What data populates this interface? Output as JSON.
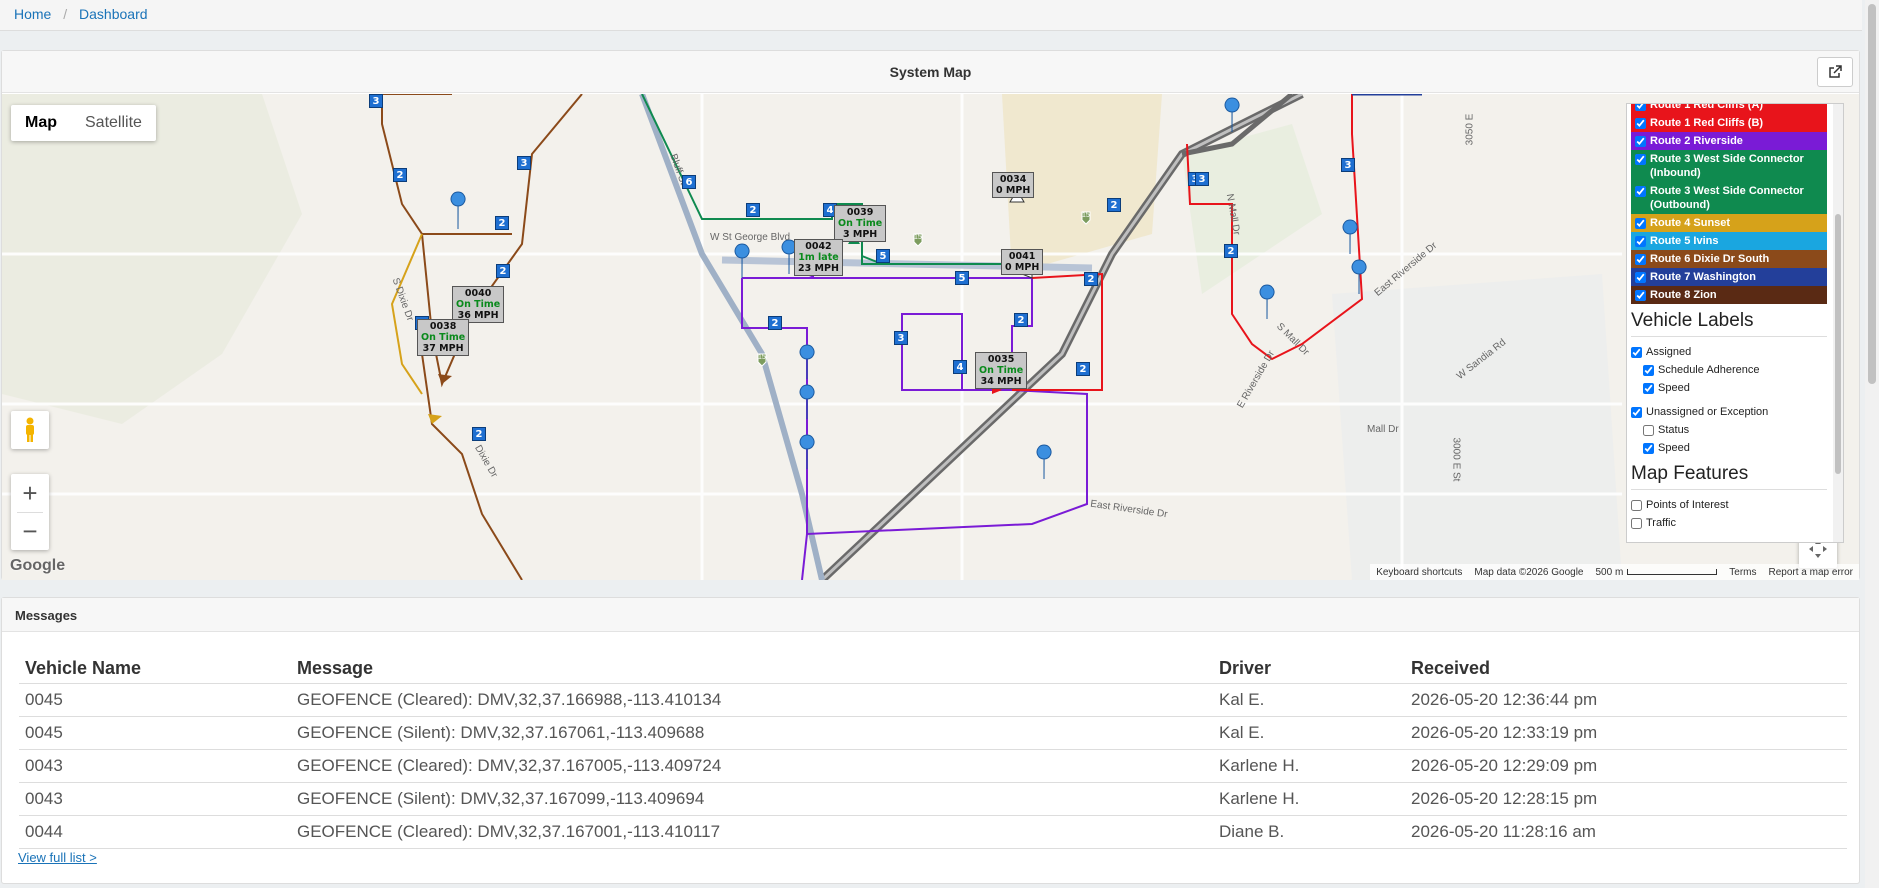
{
  "breadcrumb": {
    "home": "Home",
    "dashboard": "Dashboard"
  },
  "map_panel": {
    "title": "System Map"
  },
  "map": {
    "type_map": "Map",
    "type_satellite": "Satellite",
    "logo": "Google",
    "attrib": {
      "shortcuts": "Keyboard shortcuts",
      "data": "Map data ©2026 Google",
      "scale": "500 m",
      "terms": "Terms",
      "report": "Report a map error"
    },
    "streets": {
      "st_george": "W St George Blvd",
      "east_riverside": "East Riverside Dr",
      "east_riverside2": "East Riverside Dr",
      "e_riverside": "E Riverside Dr",
      "mall_dr": "Mall Dr",
      "n_mall": "N Mall Dr",
      "s_mall": "S Mall Dr",
      "sandia": "W Sandia Rd",
      "e3050": "3050 E",
      "e3000": "3000 E St",
      "dixie": "S Dixie Dr",
      "bluff": "Bluff St",
      "dixie_dr": "Dixie Dr",
      "r_15a": "15",
      "r_15b": "15",
      "r_15c": "15"
    },
    "vehicles": [
      {
        "id": "0034",
        "status": "",
        "speed": "0 MPH"
      },
      {
        "id": "0039",
        "status": "On Time",
        "speed": "3 MPH"
      },
      {
        "id": "0042",
        "status": "1m late",
        "speed": "23 MPH"
      },
      {
        "id": "0041",
        "status": "",
        "speed": "0 MPH"
      },
      {
        "id": "0040",
        "status": "On Time",
        "speed": "36 MPH"
      },
      {
        "id": "0038",
        "status": "On Time",
        "speed": "37 MPH"
      },
      {
        "id": "0035",
        "status": "On Time",
        "speed": "34 MPH"
      }
    ],
    "stops": [
      "3",
      "2",
      "3",
      "2",
      "2",
      "6",
      "2",
      "4",
      "3",
      "5",
      "5",
      "2",
      "2",
      "3",
      "4",
      "2",
      "2",
      "4",
      "2",
      "2",
      "3",
      "2",
      "3",
      "2"
    ]
  },
  "legend": {
    "routes": [
      {
        "label": "Route 1 Red Cliffs (A)",
        "color": "#e8141b"
      },
      {
        "label": "Route 1 Red Cliffs (B)",
        "color": "#e8141b"
      },
      {
        "label": "Route 2 Riverside",
        "color": "#7a1bd6"
      },
      {
        "label": "Route 3 West Side Connector (Inbound)",
        "color": "#0f8a4f"
      },
      {
        "label": "Route 3 West Side Connector (Outbound)",
        "color": "#0f8a4f"
      },
      {
        "label": "Route 4 Sunset",
        "color": "#d6a21a"
      },
      {
        "label": "Route 5 Ivins",
        "color": "#1aa6e0"
      },
      {
        "label": "Route 6 Dixie Dr South",
        "color": "#8b4a1a"
      },
      {
        "label": "Route 7 Washington",
        "color": "#233f9a"
      },
      {
        "label": "Route 8 Zion",
        "color": "#5a2a14"
      }
    ],
    "vehicle_labels": "Vehicle Labels",
    "assigned": "Assigned",
    "schedule_adherence": "Schedule Adherence",
    "speed": "Speed",
    "unassigned": "Unassigned or Exception",
    "status": "Status",
    "speed2": "Speed",
    "map_features": "Map Features",
    "poi": "Points of Interest",
    "traffic": "Traffic"
  },
  "messages": {
    "title": "Messages",
    "columns": [
      "Vehicle Name",
      "Message",
      "Driver",
      "Received"
    ],
    "rows": [
      [
        "0045",
        "GEOFENCE (Cleared): DMV,32,37.166988,-113.410134",
        "Kal E.",
        "2026-05-20 12:36:44 pm"
      ],
      [
        "0045",
        "GEOFENCE (Silent): DMV,32,37.167061,-113.409688",
        "Kal E.",
        "2026-05-20 12:33:19 pm"
      ],
      [
        "0043",
        "GEOFENCE (Cleared): DMV,32,37.167005,-113.409724",
        "Karlene H.",
        "2026-05-20 12:29:09 pm"
      ],
      [
        "0043",
        "GEOFENCE (Silent): DMV,32,37.167099,-113.409694",
        "Karlene H.",
        "2026-05-20 12:28:15 pm"
      ],
      [
        "0044",
        "GEOFENCE (Cleared): DMV,32,37.167001,-113.410117",
        "Diane B.",
        "2026-05-20 11:28:16 am"
      ]
    ],
    "view_full": "View full list >"
  }
}
